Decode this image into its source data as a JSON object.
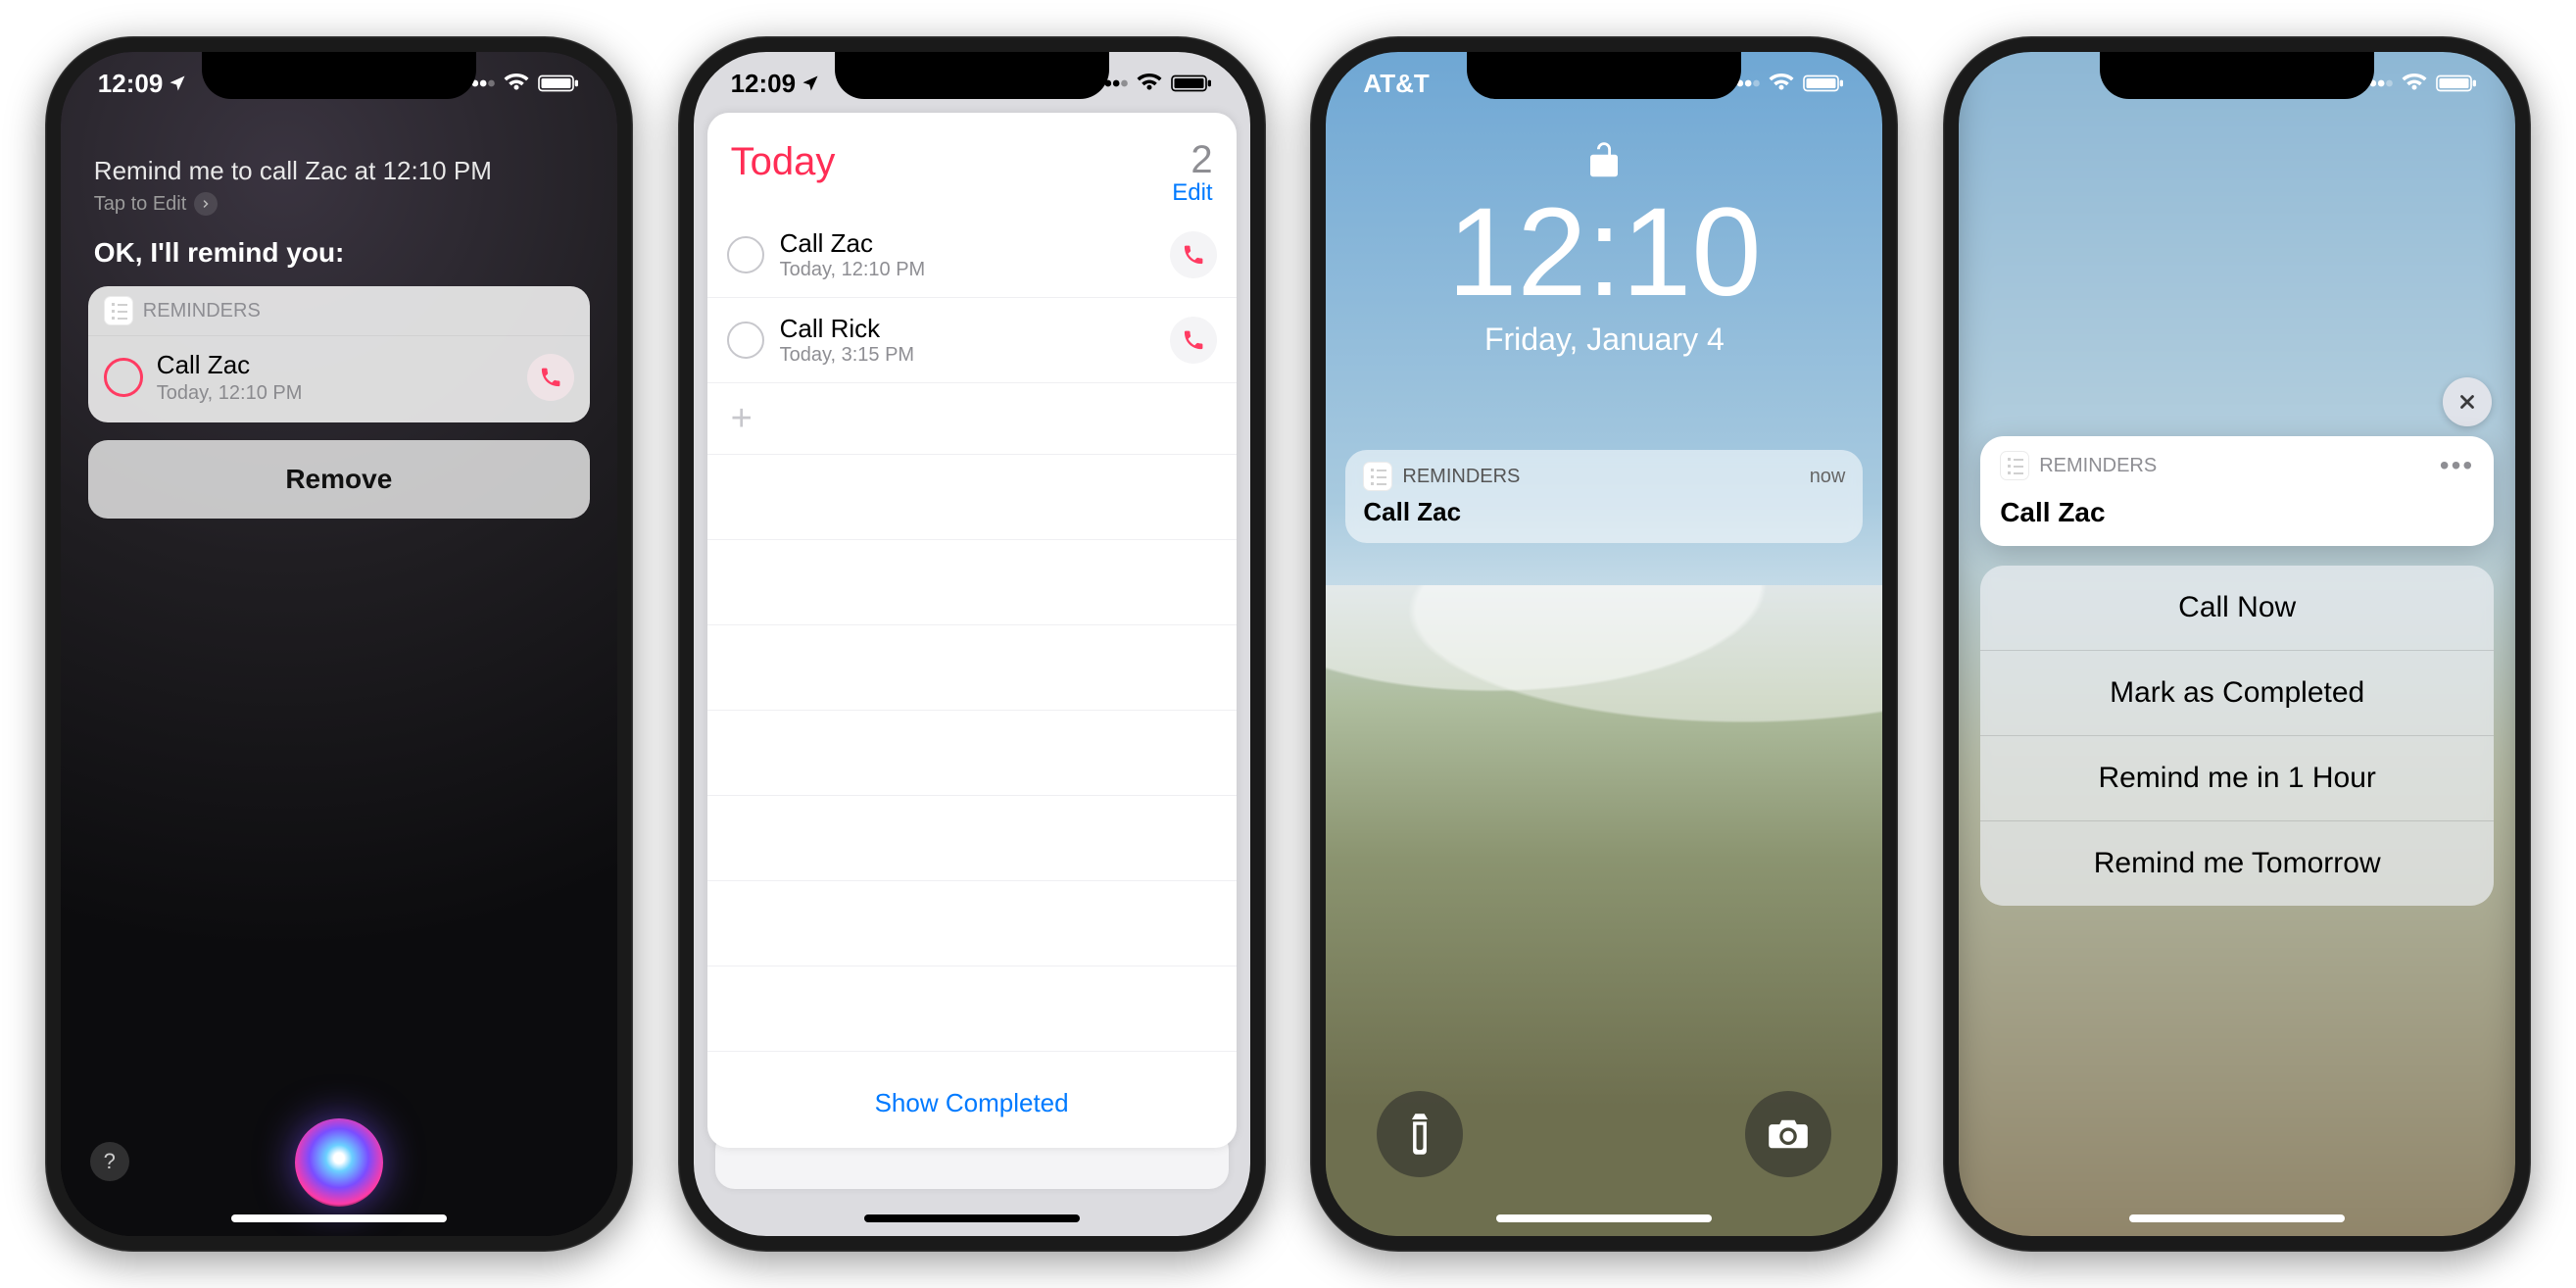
{
  "phone1": {
    "status": {
      "time": "12:09"
    },
    "siri_query": "Remind me to call Zac at 12:10 PM",
    "tap_to_edit": "Tap to Edit",
    "response": "OK, I'll remind you:",
    "card": {
      "app": "REMINDERS",
      "title": "Call Zac",
      "subtitle": "Today, 12:10 PM"
    },
    "remove": "Remove"
  },
  "phone2": {
    "status": {
      "time": "12:09"
    },
    "header": {
      "title": "Today",
      "count": "2",
      "edit": "Edit"
    },
    "items": [
      {
        "title": "Call Zac",
        "subtitle": "Today, 12:10 PM"
      },
      {
        "title": "Call Rick",
        "subtitle": "Today, 3:15 PM"
      }
    ],
    "show_completed": "Show Completed"
  },
  "phone3": {
    "status": {
      "carrier": "AT&T"
    },
    "time": "12:10",
    "date": "Friday, January 4",
    "notif": {
      "app": "REMINDERS",
      "time": "now",
      "message": "Call Zac"
    }
  },
  "phone4": {
    "notif": {
      "app": "REMINDERS",
      "message": "Call Zac"
    },
    "actions": [
      "Call Now",
      "Mark as Completed",
      "Remind me in 1 Hour",
      "Remind me Tomorrow"
    ]
  }
}
